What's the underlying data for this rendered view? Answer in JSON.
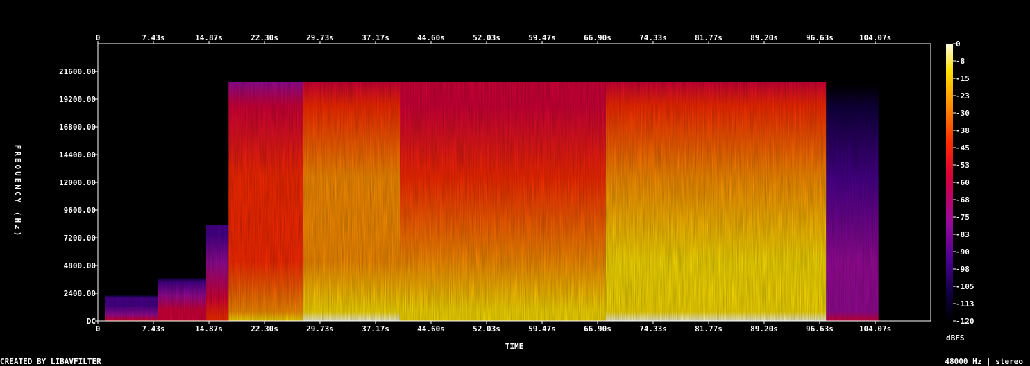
{
  "chart_data": {
    "type": "heatmap",
    "title": "",
    "xlabel": "TIME",
    "ylabel": "FREQUENCY (Hz)",
    "x_unit": "s",
    "xlim": [
      0,
      111.5
    ],
    "ylim": [
      0,
      24000
    ],
    "x_ticks": [
      "0",
      "7.43s",
      "14.87s",
      "22.30s",
      "29.73s",
      "37.17s",
      "44.60s",
      "52.03s",
      "59.47s",
      "66.90s",
      "74.33s",
      "81.77s",
      "89.20s",
      "96.63s",
      "104.07s"
    ],
    "x_tick_values": [
      0,
      7.43,
      14.87,
      22.3,
      29.73,
      37.17,
      44.6,
      52.03,
      59.47,
      66.9,
      74.33,
      81.77,
      89.2,
      96.63,
      104.07
    ],
    "y_ticks": [
      "DC",
      "2400.00",
      "4800.00",
      "7200.00",
      "9600.00",
      "12000.00",
      "14400.00",
      "16800.00",
      "19200.00",
      "21600.00"
    ],
    "y_tick_values": [
      0,
      2400,
      4800,
      7200,
      9600,
      12000,
      14400,
      16800,
      19200,
      21600
    ],
    "colorbar": {
      "unit": "dBFS",
      "ticks": [
        "0",
        "-8",
        "-15",
        "-23",
        "-30",
        "-38",
        "-45",
        "-53",
        "-60",
        "-68",
        "-75",
        "-83",
        "-90",
        "-98",
        "-105",
        "-113",
        "-120"
      ],
      "range": [
        -120,
        0
      ]
    },
    "colors": {
      "stops": [
        "#000000",
        "#100040",
        "#4a0090",
        "#9a0a9a",
        "#d8003a",
        "#ff2a00",
        "#ff9000",
        "#ffe000",
        "#fffde0"
      ]
    },
    "segments": [
      {
        "t0": 1.0,
        "t1": 8.0,
        "fmax": 2200,
        "level": 0.45
      },
      {
        "t0": 8.0,
        "t1": 14.5,
        "fmax": 3700,
        "level": 0.5
      },
      {
        "t0": 14.5,
        "t1": 17.5,
        "fmax": 8300,
        "level": 0.55
      },
      {
        "t0": 17.5,
        "t1": 27.5,
        "fmax": 20700,
        "level": 0.72
      },
      {
        "t0": 27.5,
        "t1": 40.5,
        "fmax": 20700,
        "level": 0.86
      },
      {
        "t0": 40.5,
        "t1": 55.0,
        "fmax": 20700,
        "level": 0.78
      },
      {
        "t0": 55.0,
        "t1": 68.0,
        "fmax": 20700,
        "level": 0.8
      },
      {
        "t0": 68.0,
        "t1": 97.5,
        "fmax": 20700,
        "level": 0.88
      },
      {
        "t0": 97.5,
        "t1": 104.5,
        "fmax": 20500,
        "level": 0.38
      }
    ]
  },
  "footer": {
    "credit": "CREATED BY LIBAVFILTER",
    "info": "48000 Hz | stereo"
  }
}
